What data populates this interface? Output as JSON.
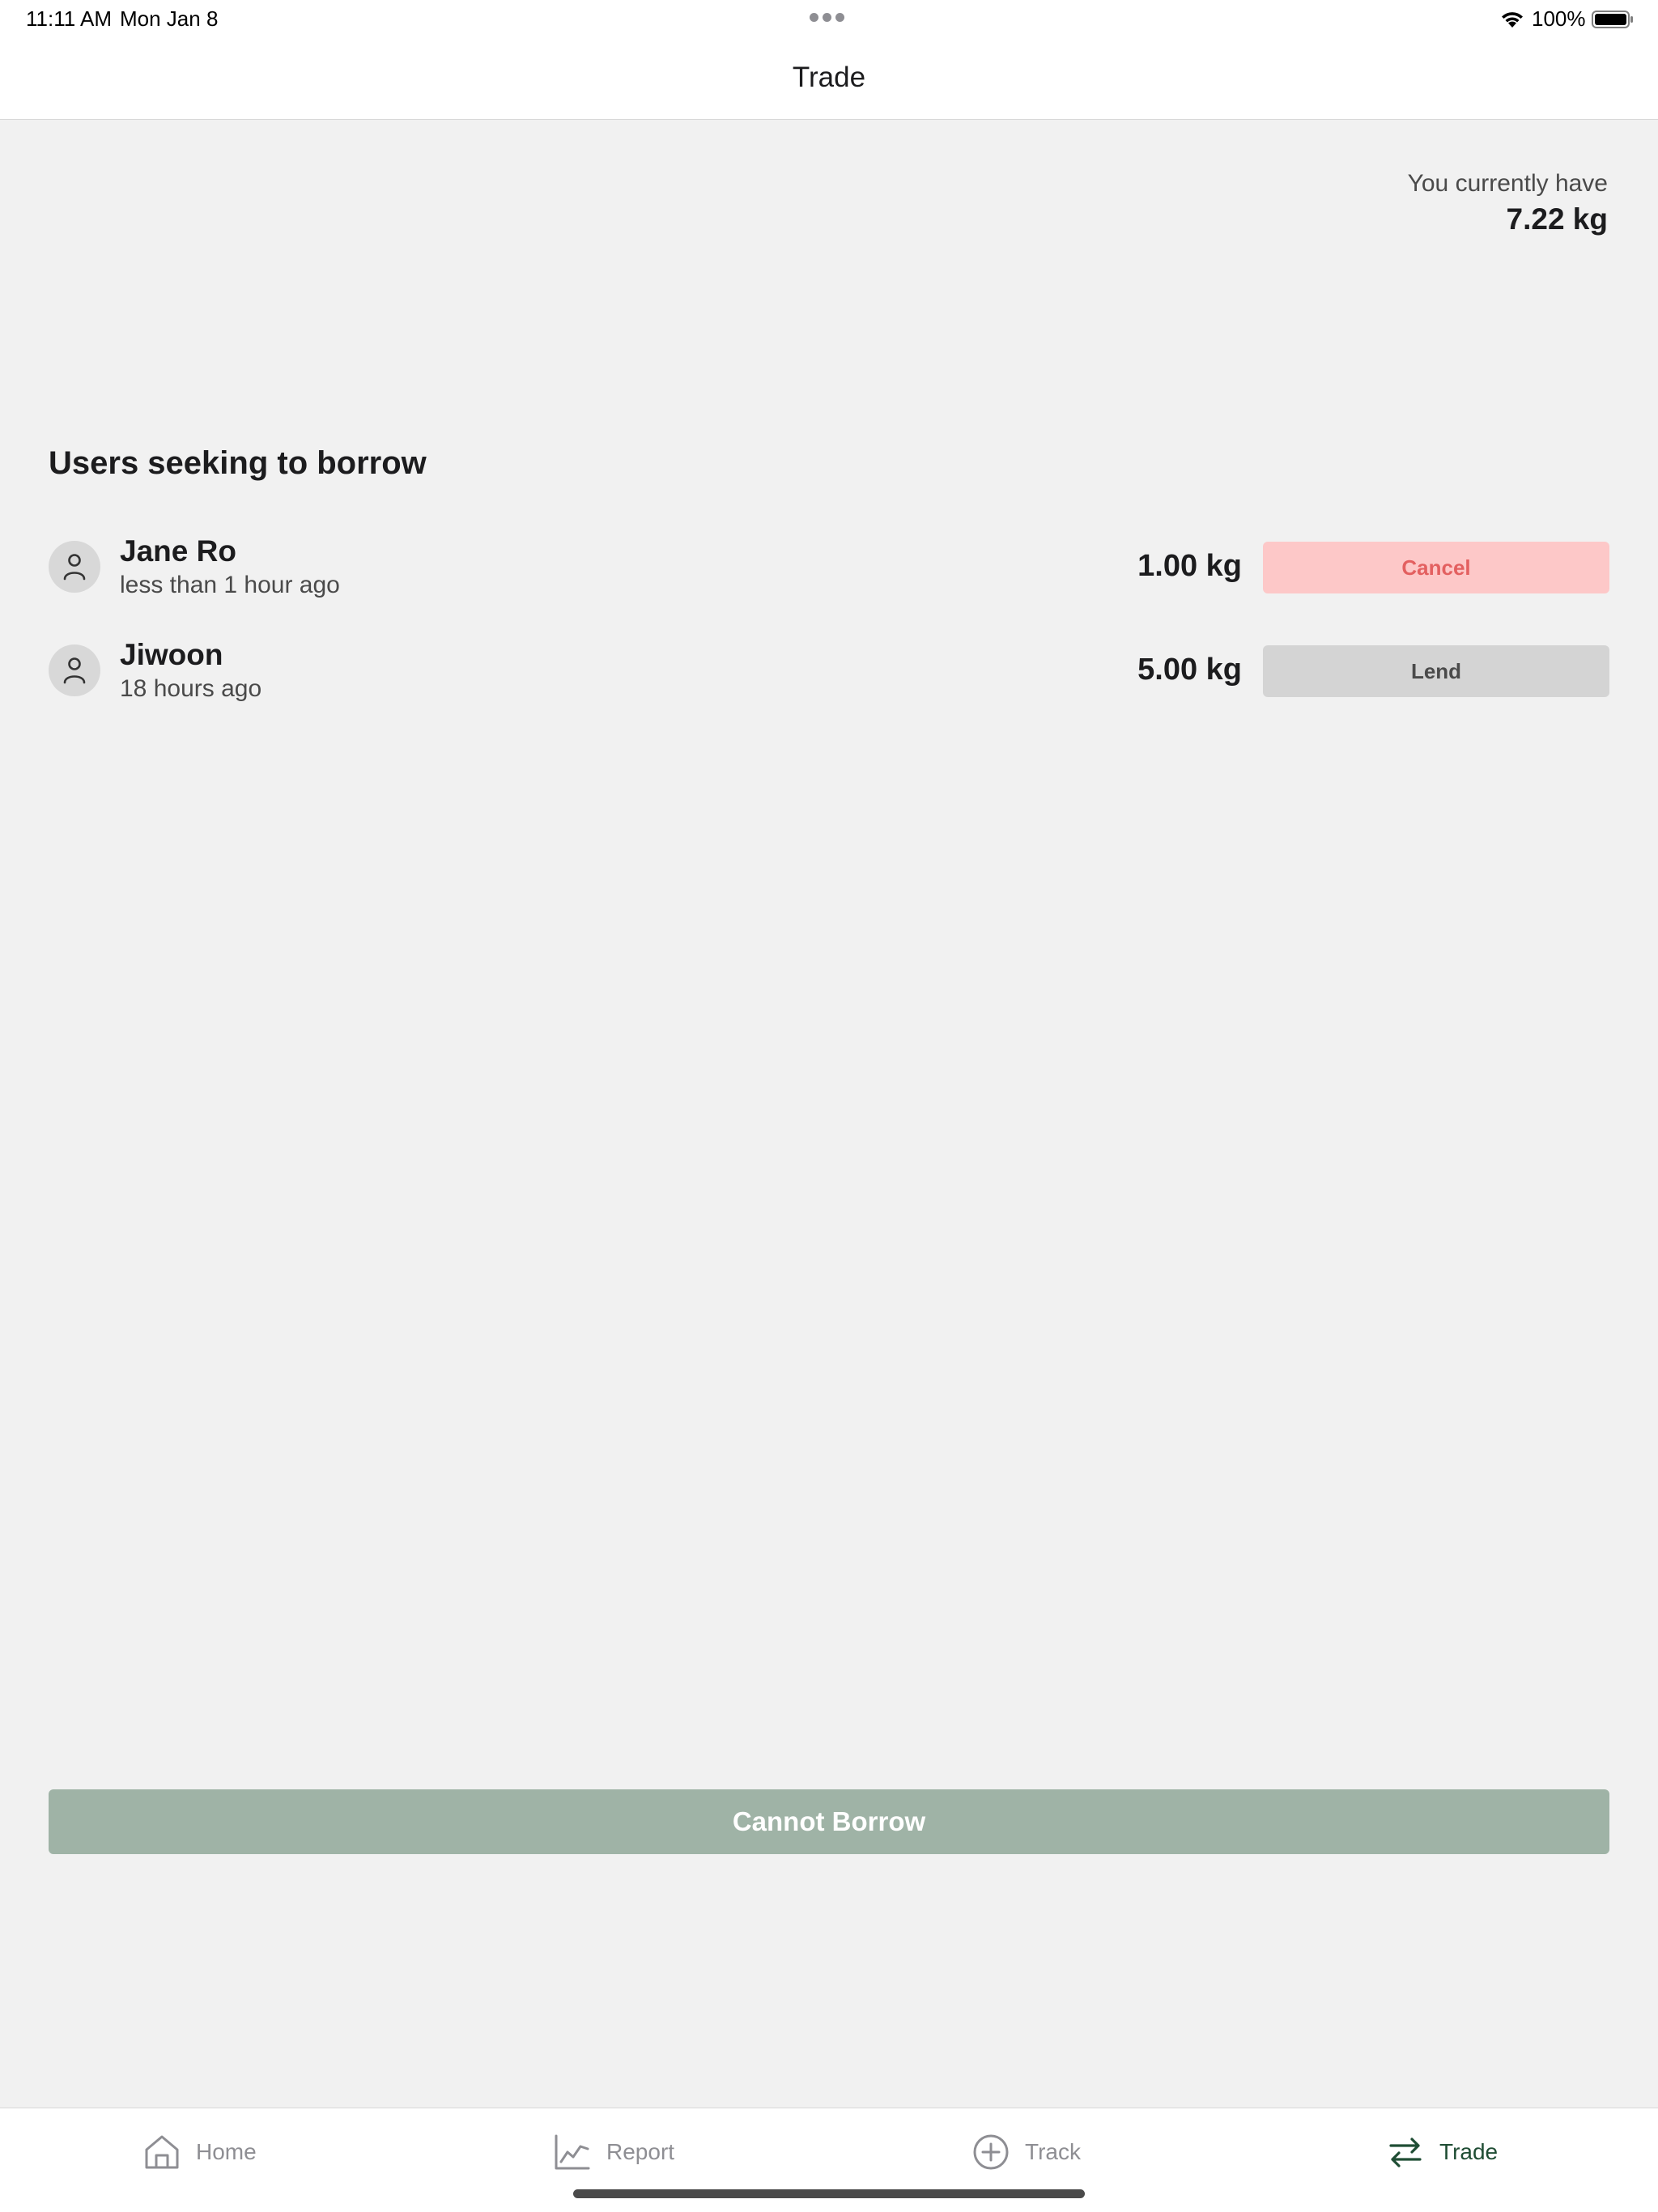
{
  "status_bar": {
    "time": "11:11 AM",
    "date": "Mon Jan 8",
    "battery_percent": "100%"
  },
  "nav": {
    "title": "Trade"
  },
  "balance": {
    "label": "You currently have",
    "value": "7.22 kg"
  },
  "section": {
    "title": "Users seeking to borrow"
  },
  "requests": [
    {
      "name": "Jane Ro",
      "time": "less than 1 hour ago",
      "amount": "1.00 kg",
      "action": "Cancel"
    },
    {
      "name": "Jiwoon",
      "time": "18 hours ago",
      "amount": "5.00 kg",
      "action": "Lend"
    }
  ],
  "borrow_button": {
    "label": "Cannot Borrow"
  },
  "tabs": [
    {
      "label": "Home",
      "icon": "home-icon"
    },
    {
      "label": "Report",
      "icon": "chart-line-icon"
    },
    {
      "label": "Track",
      "icon": "plus-circle-icon"
    },
    {
      "label": "Trade",
      "icon": "arrows-swap-icon",
      "active": true
    }
  ],
  "colors": {
    "accent": "#1f4d34",
    "cancel_bg": "#fdc8c8",
    "cancel_text": "#e36060",
    "borrow_disabled": "#9fb3a6"
  }
}
